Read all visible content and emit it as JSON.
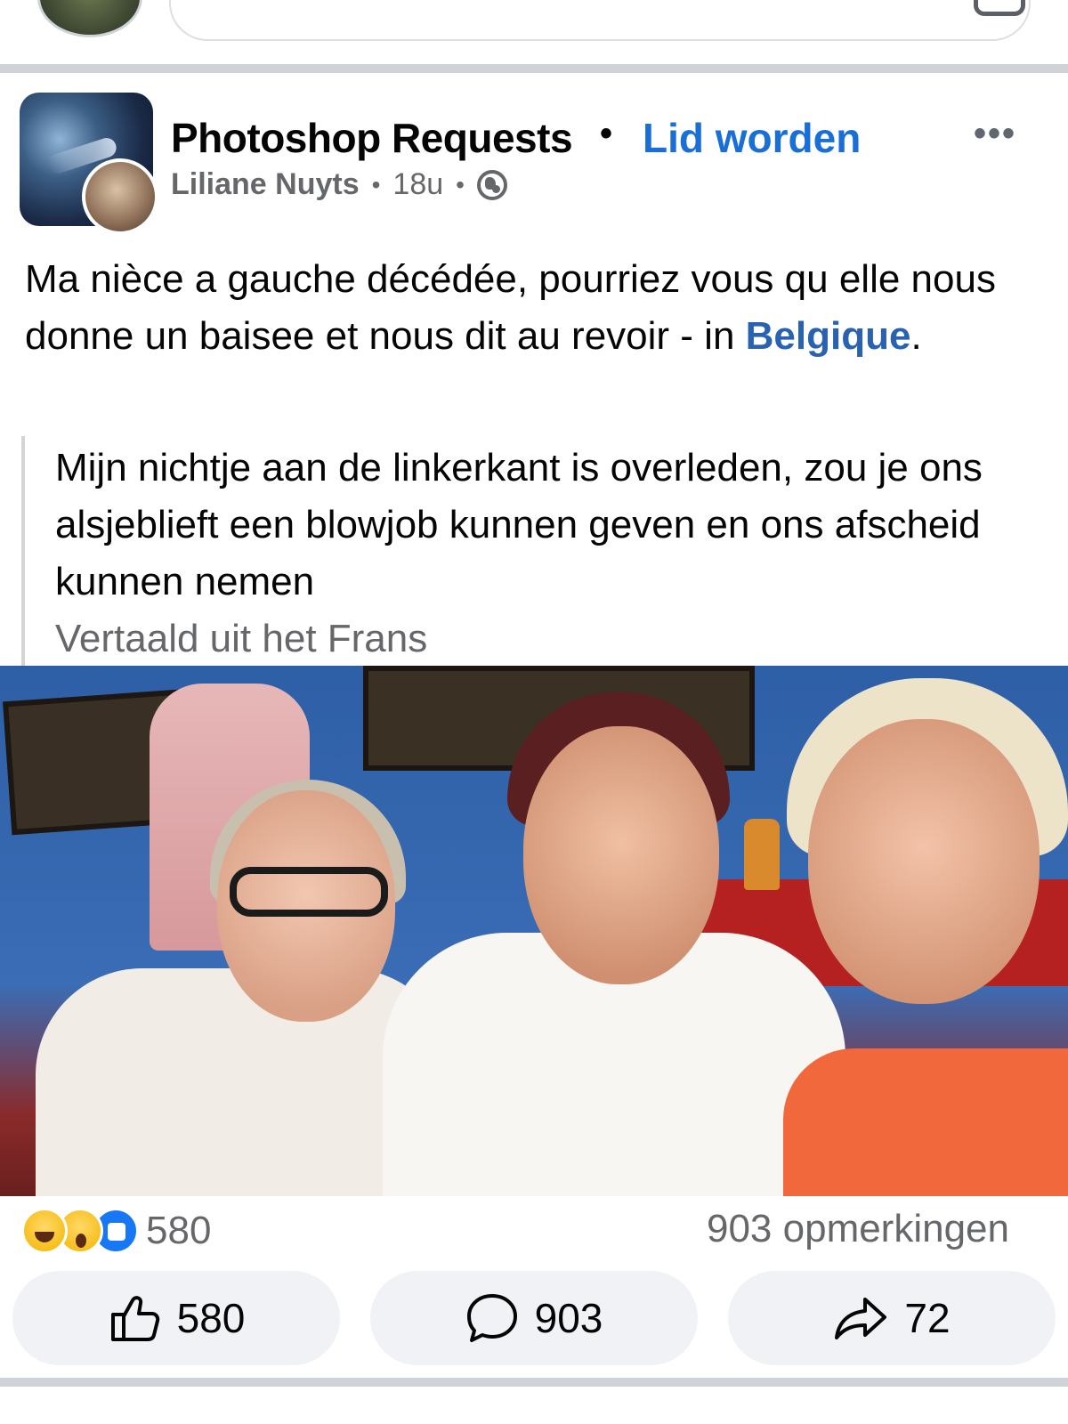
{
  "post": {
    "group": "Photoshop Requests",
    "join_label": "Lid worden",
    "author": "Liliane Nuyts",
    "time": "18u",
    "text_main": "Ma nièce a gauche décédée, pourriez vous qu elle nous donne un baisee et nous dit au revoir - in ",
    "text_link": "Belgique",
    "text_end": ".",
    "translation": "Mijn nichtje aan de linkerkant is overleden, zou je ons alsjeblieft een blowjob kunnen geven en ons afscheid kunnen nemen",
    "translated_from": "Vertaald uit het Frans"
  },
  "stats": {
    "reactions_count": "580",
    "comments": "903 opmerkingen"
  },
  "actions": {
    "like": "580",
    "comment": "903",
    "share": "72"
  },
  "icons": [
    "globe-icon",
    "more-icon",
    "like-icon",
    "comment-icon",
    "share-icon",
    "haha-reaction-icon",
    "wow-reaction-icon",
    "like-reaction-icon"
  ],
  "colors": {
    "link": "#1a6fd6",
    "muted": "#65676b",
    "button_bg": "#f0f2f5"
  }
}
